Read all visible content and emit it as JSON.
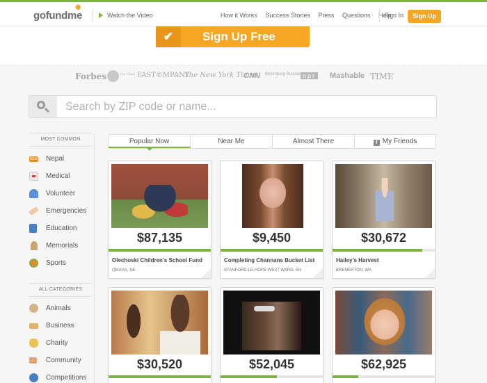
{
  "header": {
    "logo": {
      "go": "go",
      "fund": "fund",
      "me": "me"
    },
    "watch_video": "Watch the Video",
    "nav": [
      "How it Works",
      "Success Stories",
      "Press",
      "Questions",
      "Help"
    ],
    "sign_in": "Sign In",
    "sign_up": "Sign Up"
  },
  "hero": {
    "sign_up_free": "Sign Up Free"
  },
  "press": {
    "forbes": "Forbes",
    "usa": "USA TODAY",
    "fastcompany": "FAST©MPANY",
    "nyt": "The New York Times",
    "cnn": "CNN",
    "bloomberg": "Bloomberg Businessweek",
    "npr": "npr",
    "mashable": "Mashable",
    "time": "TIME"
  },
  "search": {
    "placeholder": "Search by ZIP code or name..."
  },
  "sidebar": {
    "most_common_heading": "MOST COMMON",
    "most_common": [
      {
        "label": "Nepal",
        "icon": "new-badge-icon"
      },
      {
        "label": "Medical",
        "icon": "medical-kit-icon"
      },
      {
        "label": "Volunteer",
        "icon": "volunteer-icon"
      },
      {
        "label": "Emergencies",
        "icon": "bandage-icon"
      },
      {
        "label": "Education",
        "icon": "book-icon"
      },
      {
        "label": "Memorials",
        "icon": "memorial-icon"
      },
      {
        "label": "Sports",
        "icon": "ball-icon"
      }
    ],
    "all_categories_heading": "ALL CATEGORIES",
    "all_categories": [
      {
        "label": "Animals",
        "icon": "paw-icon"
      },
      {
        "label": "Business",
        "icon": "handshake-icon"
      },
      {
        "label": "Charity",
        "icon": "coins-icon"
      },
      {
        "label": "Community",
        "icon": "signpost-icon"
      },
      {
        "label": "Competitions",
        "icon": "ribbon-icon"
      }
    ]
  },
  "tabs": [
    {
      "label": "Popular Now",
      "active": true
    },
    {
      "label": "Near Me",
      "active": false
    },
    {
      "label": "Almost There",
      "active": false
    },
    {
      "label": "My Friends",
      "active": false
    }
  ],
  "campaigns": [
    {
      "amount": "$87,135",
      "title": "Olechoski Children's School Fund",
      "location": "OMAHA, NE",
      "progress": 1.0
    },
    {
      "amount": "$9,450",
      "title": "Completing Channans Bucket List",
      "location": "STANFORD-LE-HOPE WEST WARD, EN",
      "progress": 1.0
    },
    {
      "amount": "$30,672",
      "title": "Hailey's Harvest",
      "location": "BREMERTON, WA",
      "progress": 0.88
    },
    {
      "amount": "$30,520",
      "title": "",
      "location": "",
      "progress": 1.0
    },
    {
      "amount": "$52,045",
      "title": "",
      "location": "",
      "progress": 0.55
    },
    {
      "amount": "$62,925",
      "title": "",
      "location": "",
      "progress": 0.25
    }
  ]
}
